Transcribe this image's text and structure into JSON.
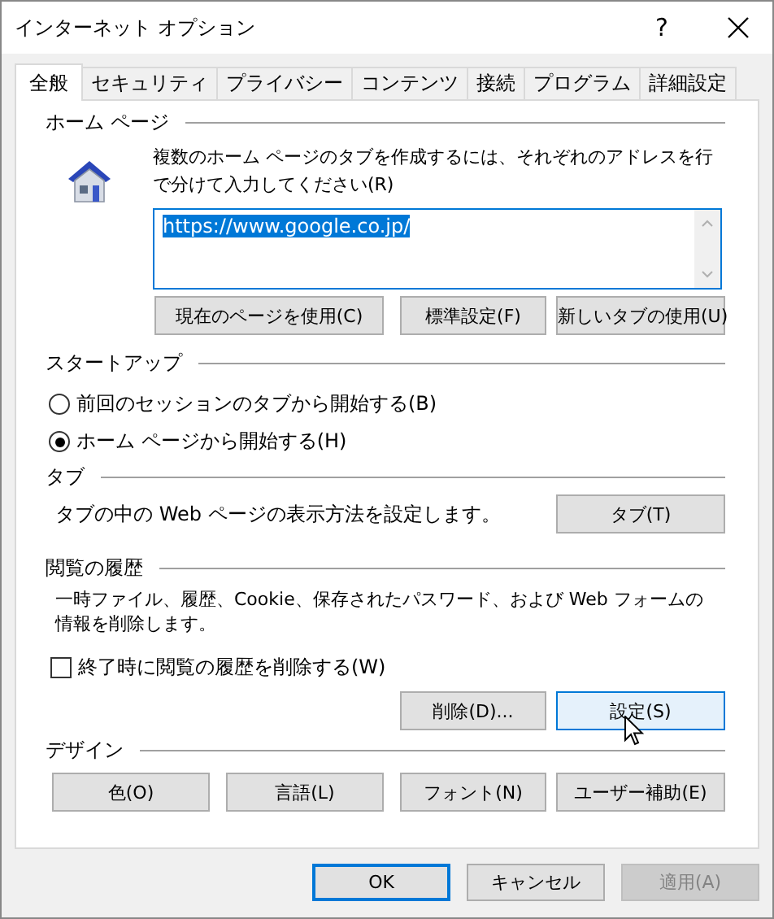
{
  "window": {
    "title": "インターネット オプション",
    "help": "?"
  },
  "tabs": [
    {
      "label": "全般",
      "selected": true
    },
    {
      "label": "セキュリティ",
      "selected": false
    },
    {
      "label": "プライバシー",
      "selected": false
    },
    {
      "label": "コンテンツ",
      "selected": false
    },
    {
      "label": "接続",
      "selected": false
    },
    {
      "label": "プログラム",
      "selected": false
    },
    {
      "label": "詳細設定",
      "selected": false
    }
  ],
  "home_page": {
    "title": "ホーム ページ",
    "description": "複数のホーム ページのタブを作成するには、それぞれのアドレスを行で分けて入力してください(R)",
    "address": "https://www.google.co.jp/",
    "address_selected": true,
    "buttons": [
      {
        "label": "現在のページを使用(C)"
      },
      {
        "label": "標準設定(F)"
      },
      {
        "label": "新しいタブの使用(U)"
      }
    ]
  },
  "startup": {
    "title": "スタートアップ",
    "options": [
      {
        "label": "前回のセッションのタブから開始する(B)",
        "selected": false
      },
      {
        "label": "ホーム ページから開始する(H)",
        "selected": true
      }
    ]
  },
  "tab_section": {
    "title": "タブ",
    "description": "タブの中の Web ページの表示方法を設定します。",
    "button": {
      "label": "タブ(T)"
    }
  },
  "history": {
    "title": "閲覧の履歴",
    "description": "一時ファイル、履歴、Cookie、保存されたパスワード、および Web フォームの情報を削除します。",
    "delete_on_exit": {
      "label": "終了時に閲覧の履歴を削除する(W)",
      "checked": false
    },
    "buttons": [
      {
        "label": "削除(D)...",
        "hovered": false
      },
      {
        "label": "設定(S)",
        "hovered": true
      }
    ]
  },
  "design": {
    "title": "デザイン",
    "buttons": [
      {
        "label": "色(O)"
      },
      {
        "label": "言語(L)"
      },
      {
        "label": "フォント(N)"
      },
      {
        "label": "ユーザー補助(E)"
      }
    ]
  },
  "footer": {
    "buttons": [
      {
        "label": "OK",
        "default": true,
        "disabled": false
      },
      {
        "label": "キャンセル",
        "default": false,
        "disabled": false
      },
      {
        "label": "適用(A)",
        "default": false,
        "disabled": true
      }
    ]
  }
}
